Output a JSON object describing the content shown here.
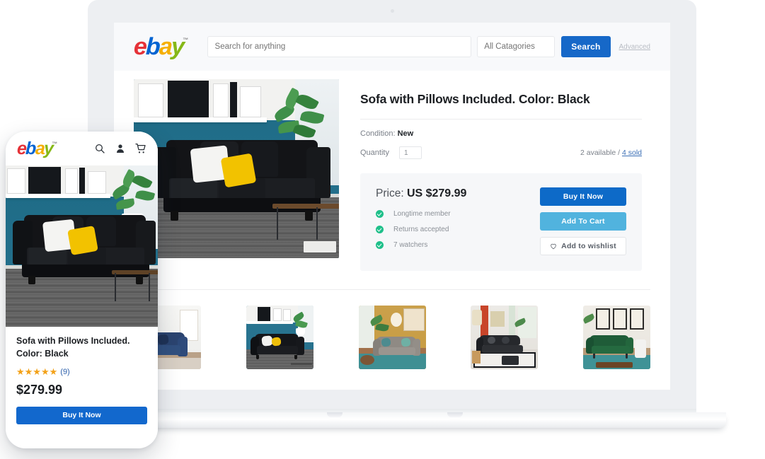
{
  "desktop": {
    "header": {
      "logo_text": "ebay",
      "logo_letters": [
        "e",
        "b",
        "a",
        "y"
      ],
      "trademark": "™",
      "search_placeholder": "Search for anything",
      "search_value": "",
      "category_placeholder": "All Catagories",
      "category_value": "",
      "search_button": "Search",
      "advanced_link": "Advanced"
    },
    "product": {
      "title": "Sofa with Pillows Included. Color: Black",
      "condition_label": "Condition:",
      "condition_value": "New",
      "quantity_label": "Quantity",
      "quantity_value": "1",
      "availability": "2 available /",
      "sold_link": "4 sold",
      "price_label": "Price:",
      "price_value": "US $279.99",
      "features": [
        {
          "label": "Longtime member"
        },
        {
          "label": "Returns accepted"
        },
        {
          "label": "7 watchers"
        }
      ],
      "buy_button": "Buy It Now",
      "cart_button": "Add To Cart",
      "wishlist_button": "Add to wishlist"
    },
    "thumbnails": [
      {
        "alt": "Navy blue sofa in bright living room"
      },
      {
        "alt": "Black sofa against teal wall with gallery shelf"
      },
      {
        "alt": "Grey loveseat in mustard-gold room with teal rug"
      },
      {
        "alt": "Black leather sectional with ottoman and red curtains"
      },
      {
        "alt": "Green velvet sofa under framed wall art"
      }
    ]
  },
  "mobile": {
    "logo_letters": [
      "e",
      "b",
      "a",
      "y"
    ],
    "trademark": "™",
    "icons": [
      "search-icon",
      "account-icon",
      "cart-icon"
    ],
    "hero_alt": "Black sofa with white and yellow pillows against teal wall",
    "title": "Sofa with Pillows Included. Color: Black",
    "rating": 5,
    "rating_stars": "★★★★★",
    "review_count": "(9)",
    "price": "$279.99",
    "buy_button": "Buy It Now"
  },
  "colors": {
    "ebay_red": "#e53238",
    "ebay_blue": "#0064d2",
    "ebay_yellow": "#f5af02",
    "ebay_green": "#86b817",
    "primary_button": "#1668c8",
    "buy_button": "#0d6ac8",
    "cart_button": "#51b3de",
    "check_green": "#1fc08a",
    "star_orange": "#f3a21a",
    "link_blue": "#3b6fb5",
    "device_frame": "#edeff2",
    "page_bg": "#ffffff",
    "header_bg": "#f8f9fb",
    "buybox_bg": "#f6f7f9"
  }
}
